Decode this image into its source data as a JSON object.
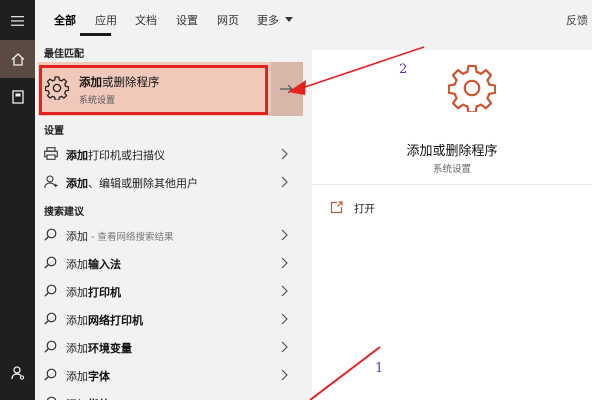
{
  "colors": {
    "accent": "#c8562e",
    "highlight_bg": "#f0c9bb",
    "annotation_red": "#e52222",
    "annotation_number": "#6a2bb0",
    "rail_bg": "#1f1f1f"
  },
  "rail": {
    "items": [
      {
        "icon": "hamburger-menu-icon"
      },
      {
        "icon": "home-icon"
      },
      {
        "icon": "notebook-icon"
      },
      {
        "icon": "user-settings-icon"
      }
    ]
  },
  "tabs": [
    {
      "label": "全部",
      "active": true
    },
    {
      "label": "应用"
    },
    {
      "label": "文档"
    },
    {
      "label": "设置"
    },
    {
      "label": "网页"
    },
    {
      "label": "更多"
    }
  ],
  "topbar_right": "反馈",
  "sections": {
    "best_match": "最佳匹配",
    "settings": "设置",
    "suggestions": "搜索建议"
  },
  "best_match": {
    "title_bold": "添加",
    "title_rest": "或删除程序",
    "subtitle": "系统设置",
    "icon": "gear-icon"
  },
  "settings_results": [
    {
      "bold": "添加",
      "rest": "打印机或扫描仪",
      "icon": "printer-icon"
    },
    {
      "bold": "添加",
      "rest": "、编辑或删除其他用户",
      "icon": "person-icon"
    }
  ],
  "suggestions": [
    {
      "plain": "添加",
      "hint": " - 查看网络搜索结果"
    },
    {
      "plain": "添加",
      "bold": "输入法"
    },
    {
      "plain": "添加",
      "bold": "打印机"
    },
    {
      "plain": "添加",
      "bold": "网络打印机"
    },
    {
      "plain": "添加",
      "bold": "环境变量"
    },
    {
      "plain": "添加",
      "bold": "字体"
    },
    {
      "plain": "添加",
      "bold": "指纹"
    }
  ],
  "detail": {
    "title": "添加或删除程序",
    "subtitle": "系统设置",
    "icon": "gear-icon",
    "actions": [
      {
        "label": "打开",
        "icon": "open-icon"
      }
    ]
  },
  "annotations": [
    "1",
    "2"
  ]
}
